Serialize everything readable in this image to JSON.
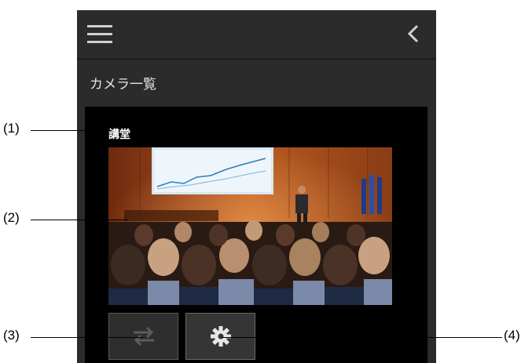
{
  "panel": {
    "title": "カメラ一覧",
    "menu_icon": "hamburger-menu-icon",
    "back_icon": "chevron-left-icon"
  },
  "camera": {
    "name": "講堂",
    "thumbnail": "auditorium-live-thumbnail",
    "switch_icon": "swap-arrows-icon",
    "settings_icon": "gear-icon",
    "switch_enabled": false
  },
  "callouts": [
    "(1)",
    "(2)",
    "(3)",
    "(4)"
  ],
  "colors": {
    "panel_bg": "#2b2b2b",
    "card_bg": "#000000",
    "button_bg": "#2e2e2e",
    "text": "#e3e3e3"
  }
}
